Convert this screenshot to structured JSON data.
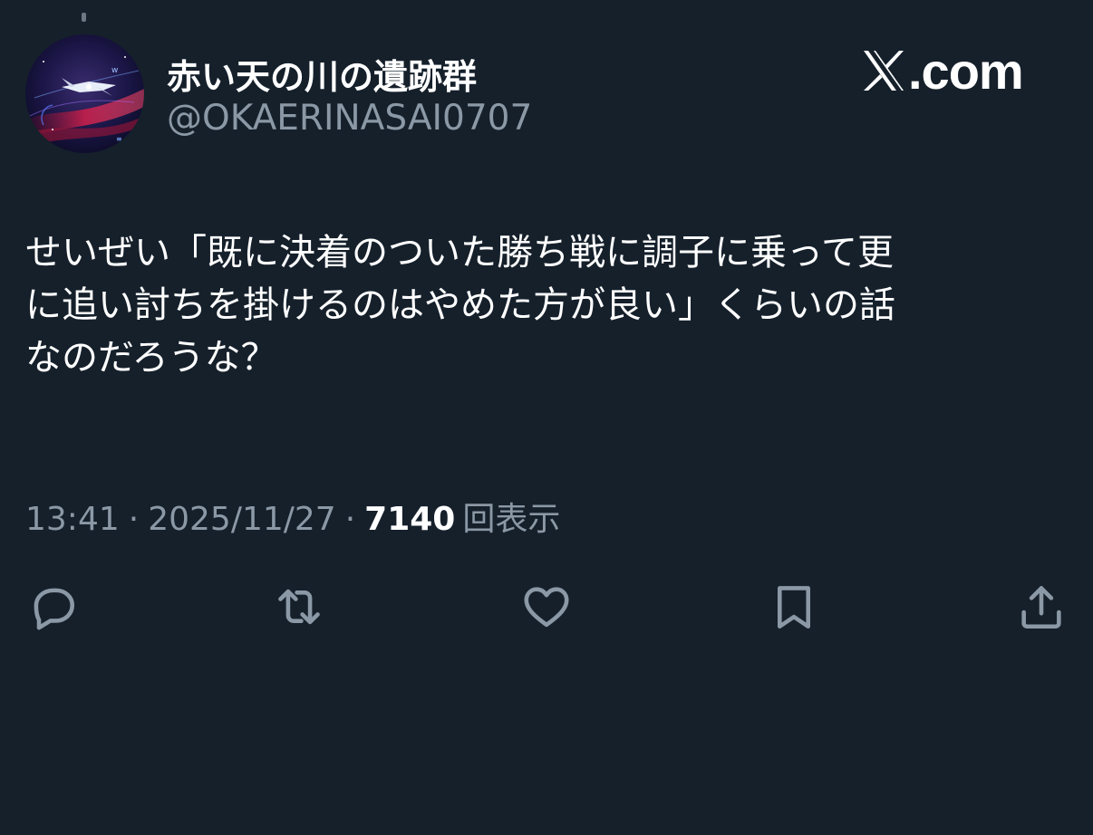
{
  "header": {
    "display_name": "赤い天の川の遺跡群",
    "handle": "@OKAERINASAI0707",
    "brand": ".com",
    "brand_icon": "x-logo-icon"
  },
  "tweet": {
    "lines": [
      "せいぜい「既に決着のついた勝ち戦に調子に乗って更",
      "に追い討ちを掛けるのはやめた方が良い」くらいの話",
      "なのだろうな？"
    ],
    "time": "13:41",
    "separator": "·",
    "date": "2025/11/27",
    "views_count": "7140",
    "views_label": "回表示"
  },
  "actions": [
    {
      "name": "reply-button",
      "icon": "speech-bubble-icon"
    },
    {
      "name": "retweet-button",
      "icon": "retweet-arrows-icon"
    },
    {
      "name": "like-button",
      "icon": "heart-icon"
    },
    {
      "name": "bookmark-button",
      "icon": "bookmark-icon"
    },
    {
      "name": "share-button",
      "icon": "share-upload-icon"
    }
  ],
  "colors": {
    "background": "#15202b",
    "primary_text": "#ffffff",
    "secondary_text": "#8b98a5"
  }
}
